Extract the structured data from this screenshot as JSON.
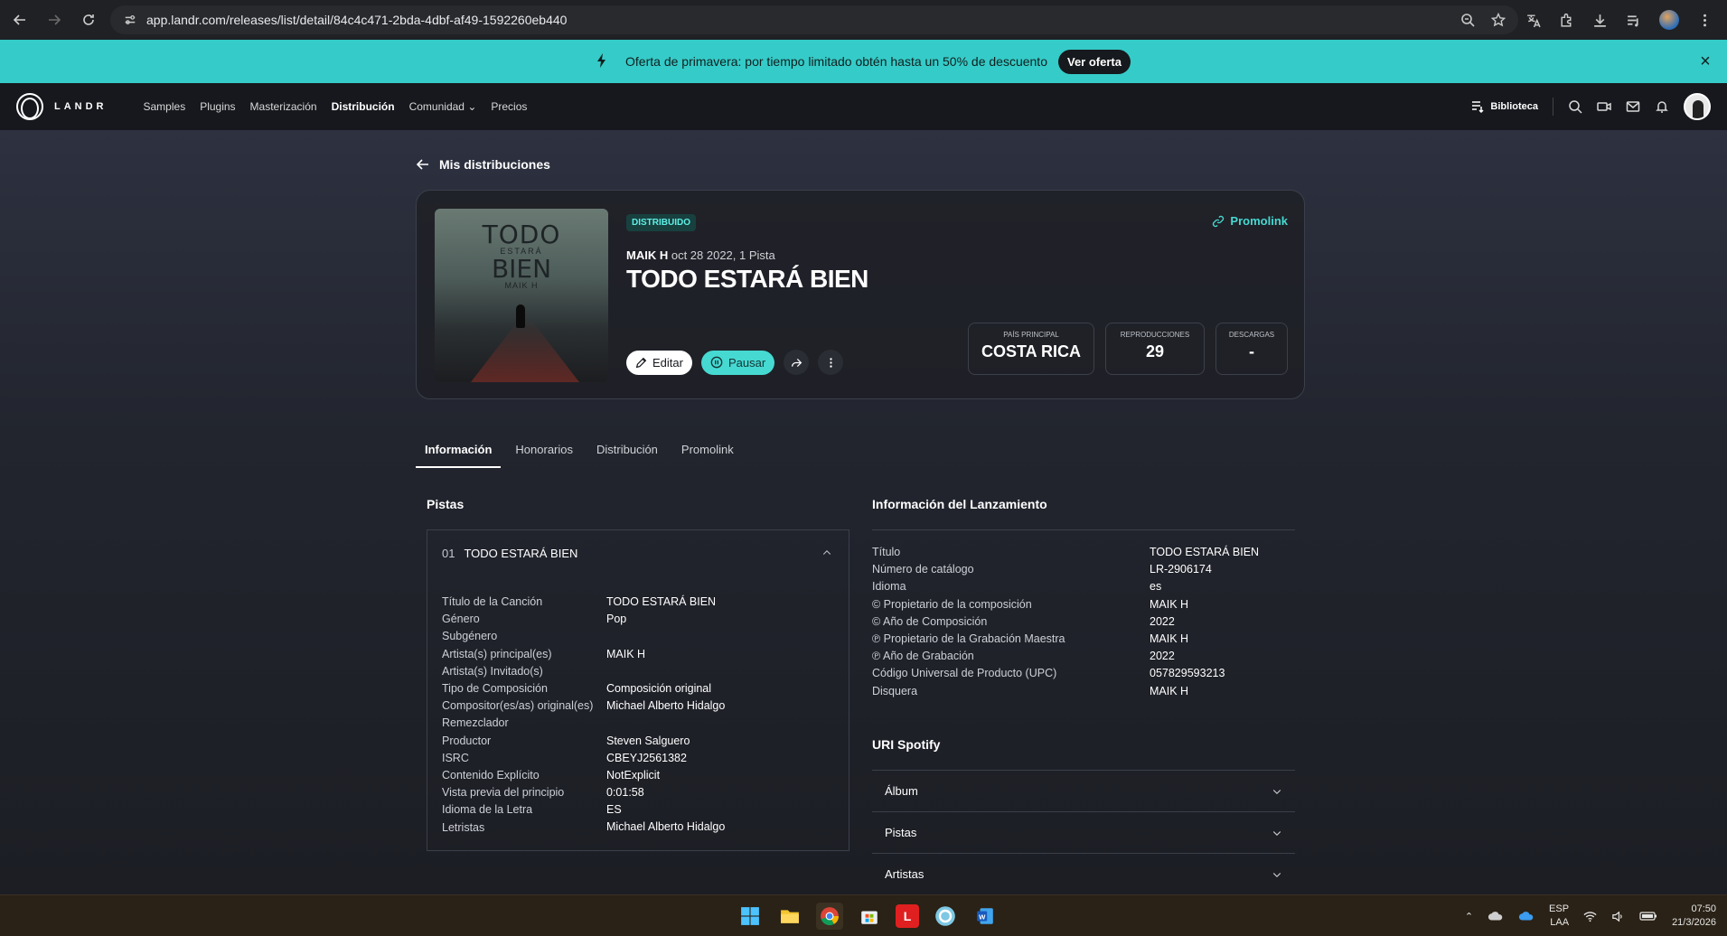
{
  "browser": {
    "url": "app.landr.com/releases/list/detail/84c4c471-2bda-4dbf-af49-1592260eb440"
  },
  "promo": {
    "text": "Oferta de primavera: por tiempo limitado obtén hasta un 50% de descuento",
    "button": "Ver oferta"
  },
  "header": {
    "logo": "LANDR",
    "nav": [
      "Samples",
      "Plugins",
      "Masterización",
      "Distribución",
      "Comunidad",
      "Precios"
    ],
    "active_nav": "Distribución",
    "library": "Biblioteca"
  },
  "back_label": "Mis distribuciones",
  "release": {
    "status": "DISTRIBUIDO",
    "artist": "MAIK H",
    "date_tracks": "oct 28 2022, 1 Pista",
    "title": "TODO ESTARÁ BIEN",
    "promolink": "Promolink",
    "cover": {
      "line1": "TODO",
      "line2": "ESTARÁ",
      "line3": "BIEN",
      "line4": "MAIK H"
    },
    "actions": {
      "edit": "Editar",
      "pause": "Pausar"
    },
    "stats": [
      {
        "label": "PAÍS PRINCIPAL",
        "value": "COSTA RICA"
      },
      {
        "label": "REPRODUCCIONES",
        "value": "29"
      },
      {
        "label": "DESCARGAS",
        "value": "-"
      }
    ]
  },
  "tabs": [
    "Información",
    "Honorarios",
    "Distribución",
    "Promolink"
  ],
  "tracks_section": {
    "title": "Pistas",
    "track_number": "01",
    "track_title": "TODO ESTARÁ BIEN",
    "details": [
      {
        "label": "Título de la Canción",
        "value": "TODO ESTARÁ BIEN"
      },
      {
        "label": "Género",
        "value": "Pop"
      },
      {
        "label": "Subgénero",
        "value": ""
      },
      {
        "label": "Artista(s) principal(es)",
        "value": "MAIK H"
      },
      {
        "label": "Artista(s) Invitado(s)",
        "value": ""
      },
      {
        "label": "Tipo de Composición",
        "value": "Composición original"
      },
      {
        "label": "Compositor(es/as) original(es)",
        "value": "Michael Alberto Hidalgo"
      },
      {
        "label": "Remezclador",
        "value": ""
      },
      {
        "label": "Productor",
        "value": "Steven Salguero"
      },
      {
        "label": "ISRC",
        "value": "CBEYJ2561382"
      },
      {
        "label": "Contenido Explícito",
        "value": "NotExplicit"
      },
      {
        "label": "Vista previa del principio",
        "value": "0:01:58"
      },
      {
        "label": "Idioma de la Letra",
        "value": "ES"
      },
      {
        "label": "Letristas",
        "value": "Michael Alberto Hidalgo"
      }
    ]
  },
  "release_info": {
    "title": "Información del Lanzamiento",
    "rows": [
      {
        "label": "Título",
        "value": "TODO ESTARÁ BIEN"
      },
      {
        "label": "Número de catálogo",
        "value": "LR-2906174"
      },
      {
        "label": "Idioma",
        "value": "es"
      },
      {
        "label": "© Propietario de la composición",
        "value": "MAIK H"
      },
      {
        "label": "© Año de Composición",
        "value": "2022"
      },
      {
        "label": "℗ Propietario de la Grabación Maestra",
        "value": "MAIK H"
      },
      {
        "label": "℗ Año de Grabación",
        "value": "2022"
      },
      {
        "label": "Código Universal de Producto (UPC)",
        "value": "057829593213"
      },
      {
        "label": "Disquera",
        "value": "MAIK H"
      }
    ]
  },
  "spotify": {
    "title": "URI Spotify",
    "sections": [
      "Álbum",
      "Pistas",
      "Artistas"
    ]
  },
  "taskbar": {
    "lang1": "ESP",
    "lang2": "LAA",
    "time": "07:50",
    "date": "21/3/2026"
  }
}
